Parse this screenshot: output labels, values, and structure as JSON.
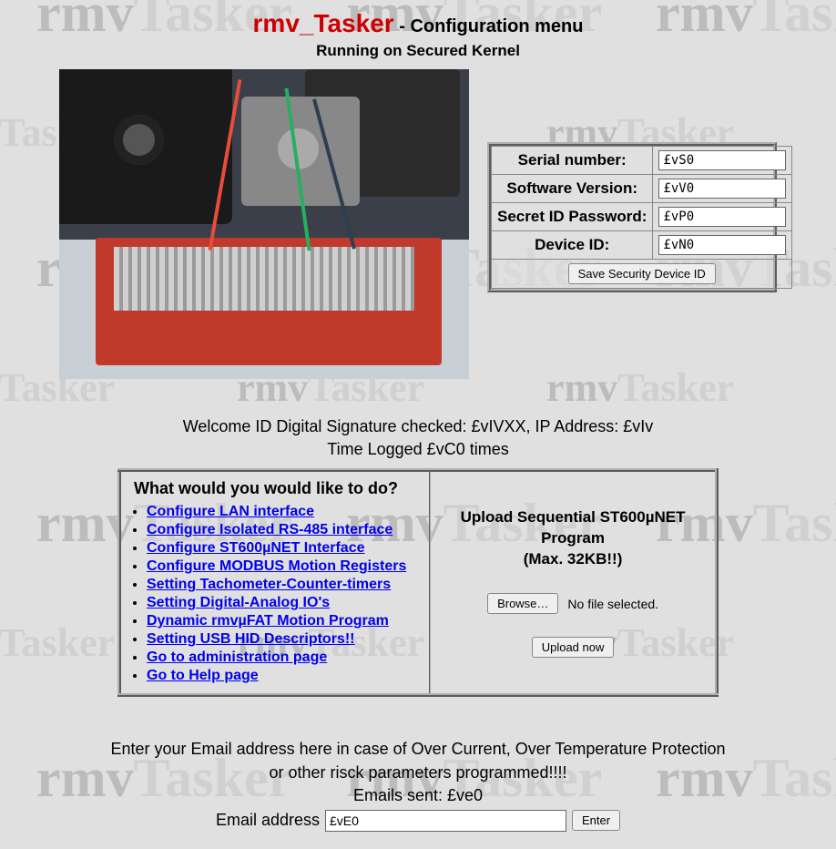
{
  "header": {
    "app_title": "rmv_Tasker",
    "subtitle": " - Configuration menu",
    "subtitle2": "Running on Secured Kernel"
  },
  "watermark": {
    "text1": "rmv",
    "text2": "Tasker"
  },
  "info": {
    "serial_label": "Serial number:",
    "serial_value": "£vS0",
    "version_label": "Software Version:",
    "version_value": "£vV0",
    "secret_label": "Secret ID Password:",
    "secret_value": "£vP0",
    "device_label": "Device ID:",
    "device_value": "£vN0",
    "save_button": "Save Security Device ID"
  },
  "welcome": {
    "line1": "Welcome ID Digital Signature checked: £vIVXX, IP Address: £vIv",
    "line2": "Time Logged £vC0 times"
  },
  "actions": {
    "prompt": "What would you would like to do?",
    "links": [
      "Configure LAN interface",
      "Configure Isolated RS-485 interface",
      "Configure ST600µNET Interface",
      "Configure MODBUS Motion Registers",
      "Setting Tachometer-Counter-timers",
      "Setting Digital-Analog IO's",
      "Dynamic rmvµFAT Motion Program",
      "Setting USB HID Descriptors!!",
      "Go to administration page",
      "Go to Help page"
    ]
  },
  "upload": {
    "title_line1": "Upload Sequential ST600µNET Program",
    "title_line2": "(Max. 32KB!!)",
    "browse_button": "Browse…",
    "file_status": "No file selected.",
    "upload_button": "Upload now"
  },
  "email": {
    "line1": "Enter your Email address here in case of Over Current, Over Temperature Protection",
    "line2": "or other risck parameters programmed!!!!",
    "line3": "Emails sent: £ve0",
    "label": "Email address",
    "value": "£vE0",
    "button": "Enter"
  }
}
